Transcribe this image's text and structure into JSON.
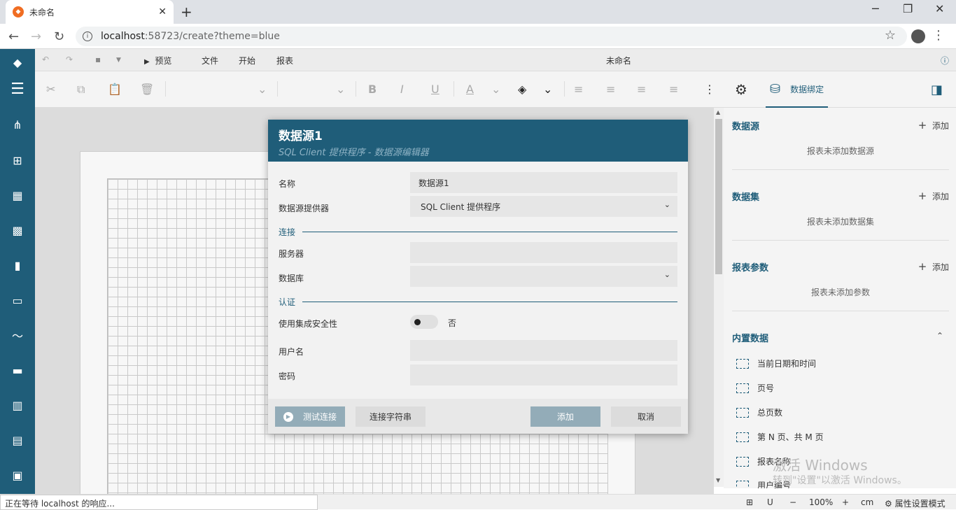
{
  "browser": {
    "tab_title": "未命名",
    "tab_close": "✕",
    "new_tab": "+",
    "url_host": "localhost",
    "url_rest": ":58723/create?theme=blue",
    "status_text": "正在等待 localhost 的响应..."
  },
  "toolbar": {
    "preview": "预览",
    "file": "文件",
    "start": "开始",
    "report": "报表",
    "doc_title": "未命名"
  },
  "right_panel": {
    "tab_label": "数据绑定",
    "add_label": "添加",
    "sections": [
      {
        "title": "数据源",
        "empty": "报表未添加数据源"
      },
      {
        "title": "数据集",
        "empty": "报表未添加数据集"
      },
      {
        "title": "报表参数",
        "empty": "报表未添加参数"
      }
    ],
    "builtin_title": "内置数据",
    "builtin_items": [
      "当前日期和时间",
      "页号",
      "总页数",
      "第 N 页、共 M 页",
      "报表名称",
      "用户编号"
    ]
  },
  "watermark": {
    "line1": "激活 Windows",
    "line2": "转到\"设置\"以激活 Windows。"
  },
  "statusbar": {
    "zoom": "100%",
    "unit": "cm",
    "mode": "属性设置模式"
  },
  "dialog": {
    "title": "数据源1",
    "subtitle": "SQL Client 提供程序 - 数据源编辑器",
    "name_label": "名称",
    "name_value": "数据源1",
    "provider_label": "数据源提供器",
    "provider_value": "SQL Client 提供程序",
    "group_connection": "连接",
    "server_label": "服务器",
    "server_value": "",
    "database_label": "数据库",
    "database_value": "",
    "group_auth": "认证",
    "integrated_label": "使用集成安全性",
    "integrated_value": "否",
    "username_label": "用户名",
    "username_value": "",
    "password_label": "密码",
    "password_value": "",
    "btn_test": "测试连接",
    "btn_conn_string": "连接字符串",
    "btn_add": "添加",
    "btn_cancel": "取消"
  }
}
